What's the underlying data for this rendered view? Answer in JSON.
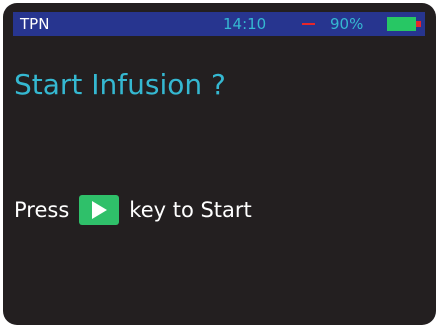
{
  "status_bar": {
    "mode": "TPN",
    "time": "14:10",
    "battery_percent_text": "90%",
    "battery_level": 0.9,
    "icons": [
      "alarm-dash-icon",
      "battery-icon"
    ],
    "colors": {
      "bar_background": "#27358f",
      "text": "#35b8d1",
      "alarm": "#e8262a",
      "battery": "#27c764"
    }
  },
  "screen": {
    "title": "Start Infusion ?",
    "instruction_prefix": "Press",
    "instruction_suffix": "key to Start",
    "key_icon": "play-icon",
    "colors": {
      "background": "#231f20",
      "title": "#35b8d1",
      "key": "#2fc06a"
    }
  }
}
